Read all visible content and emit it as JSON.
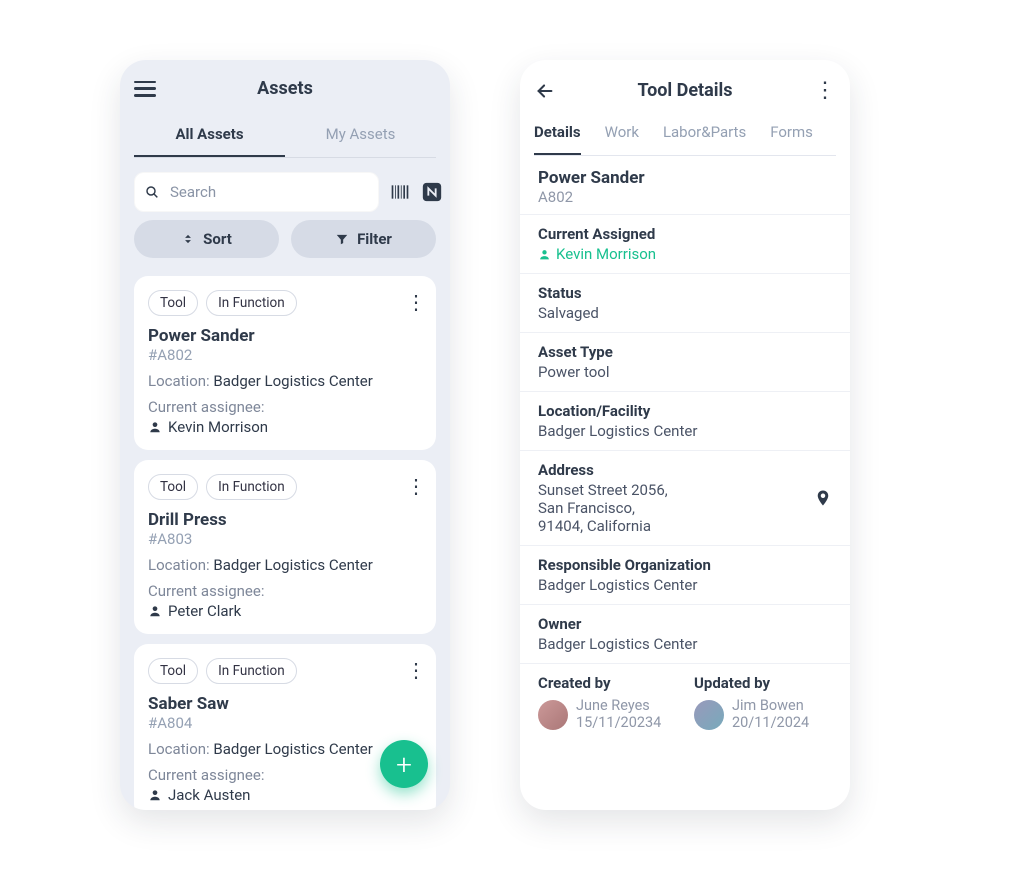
{
  "left": {
    "title": "Assets",
    "tabs": [
      "All Assets",
      "My Assets"
    ],
    "activeTab": 0,
    "search_placeholder": "Search",
    "sort_label": "Sort",
    "filter_label": "Filter",
    "location_label": "Location:",
    "assignee_label": "Current assignee:",
    "cards": [
      {
        "chips": [
          "Tool",
          "In Function"
        ],
        "name": "Power Sander",
        "id": "#A802",
        "location": "Badger Logistics Center",
        "assignee": "Kevin Morrison"
      },
      {
        "chips": [
          "Tool",
          "In Function"
        ],
        "name": "Drill Press",
        "id": "#A803",
        "location": "Badger Logistics Center",
        "assignee": "Peter Clark"
      },
      {
        "chips": [
          "Tool",
          "In Function"
        ],
        "name": "Saber Saw",
        "id": "#A804",
        "location": "Badger Logistics Center",
        "assignee": "Jack Austen"
      }
    ]
  },
  "right": {
    "title": "Tool Details",
    "tabs": [
      "Details",
      "Work",
      "Labor&Parts",
      "Forms"
    ],
    "activeTab": 0,
    "asset_name": "Power Sander",
    "asset_id": "A802",
    "sections": {
      "assigned_label": "Current Assigned",
      "assigned_name": "Kevin Morrison",
      "status_label": "Status",
      "status_value": "Salvaged",
      "type_label": "Asset Type",
      "type_value": "Power tool",
      "location_label": "Location/Facility",
      "location_value": "Badger Logistics Center",
      "address_label": "Address",
      "address_value": "Sunset Street 2056,\nSan Francisco,\n91404, California",
      "org_label": "Responsible Organization",
      "org_value": "Badger Logistics Center",
      "owner_label": "Owner",
      "owner_value": "Badger Logistics Center"
    },
    "created_label": "Created by",
    "created_name": "June Reyes",
    "created_date": "15/11/20234",
    "updated_label": "Updated by",
    "updated_name": "Jim Bowen",
    "updated_date": "20/11/2024"
  }
}
